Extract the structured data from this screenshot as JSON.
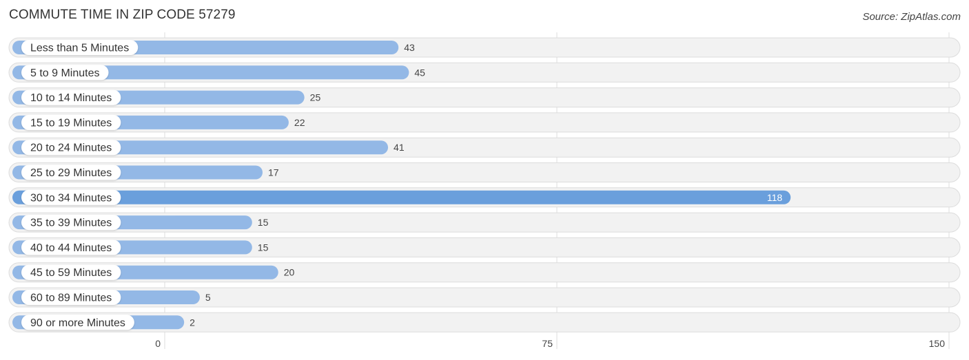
{
  "header": {
    "title": "COMMUTE TIME IN ZIP CODE 57279",
    "source": "Source: ZipAtlas.com"
  },
  "colors": {
    "bar": "#93b8e6",
    "bar_highlight": "#6a9fdc",
    "track": "#f2f2f2"
  },
  "chart_data": {
    "type": "bar",
    "orientation": "horizontal",
    "title": "COMMUTE TIME IN ZIP CODE 57279",
    "xlabel": "",
    "ylabel": "",
    "categories": [
      "Less than 5 Minutes",
      "5 to 9 Minutes",
      "10 to 14 Minutes",
      "15 to 19 Minutes",
      "20 to 24 Minutes",
      "25 to 29 Minutes",
      "30 to 34 Minutes",
      "35 to 39 Minutes",
      "40 to 44 Minutes",
      "45 to 59 Minutes",
      "60 to 89 Minutes",
      "90 or more Minutes"
    ],
    "values": [
      43,
      45,
      25,
      22,
      41,
      17,
      118,
      15,
      15,
      20,
      5,
      2
    ],
    "highlight_index": 6,
    "xlim": [
      0,
      150
    ],
    "xticks": [
      0,
      75,
      150
    ],
    "xtick_labels": [
      "0",
      "75",
      "150"
    ],
    "grid": true,
    "legend": "none"
  }
}
